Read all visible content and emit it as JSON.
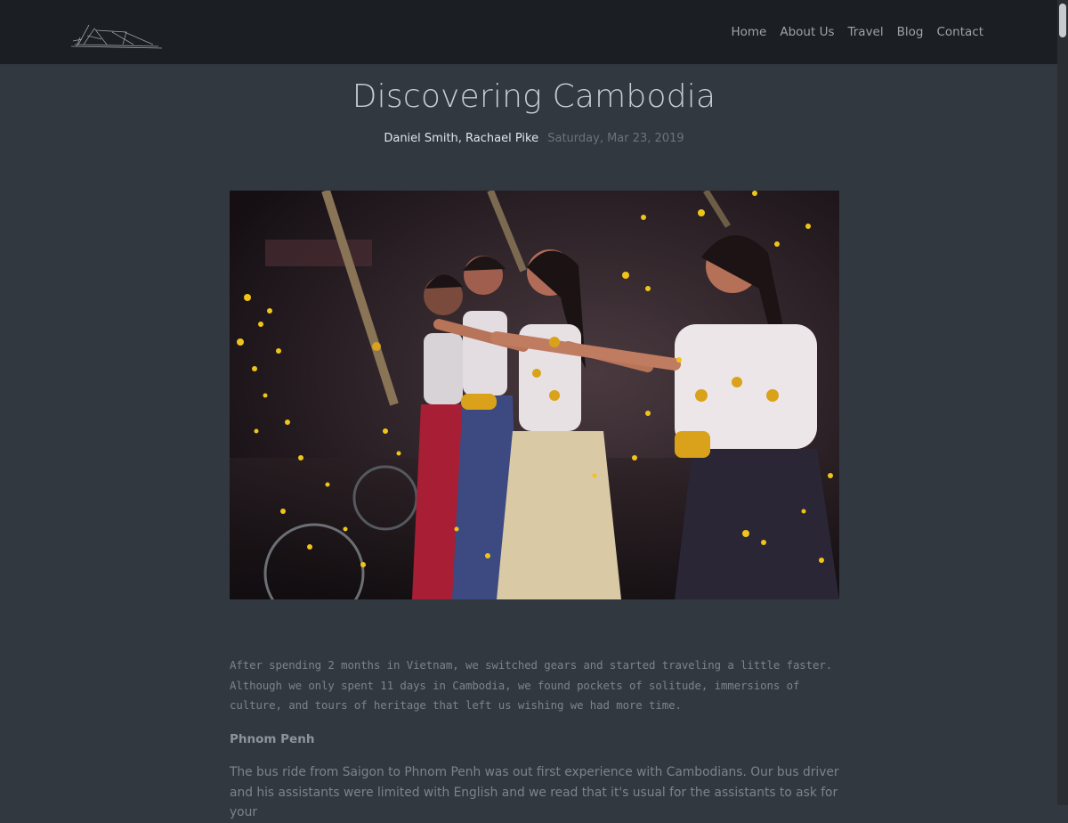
{
  "nav": {
    "logo_icon": "boat-sketch-logo",
    "links": [
      "Home",
      "About Us",
      "Travel",
      "Blog",
      "Contact"
    ]
  },
  "post": {
    "title": "Discovering Cambodia",
    "authors": "Daniel Smith, Rachael Pike",
    "date": "Saturday, Mar 23, 2019",
    "intro": "After spending 2 months in Vietnam, we switched gears and started traveling a little faster. Although we only spent 11 days in Cambodia, we found pockets of solitude, immersions of culture, and tours of heritage that left us wishing we had more time.",
    "section_heading": "Phnom Penh",
    "section_text": "The bus ride from Saigon to Phnom Penh was out first experience with Cambodians. Our bus driver and his assistants were limited with English and we read that it's usual for the assistants to ask for your"
  },
  "colors": {
    "page_bg": "#323840",
    "nav_bg": "#1b1e22",
    "title": "#c7ccd2",
    "authors": "#e2e5e8",
    "muted": "#6b727a"
  }
}
